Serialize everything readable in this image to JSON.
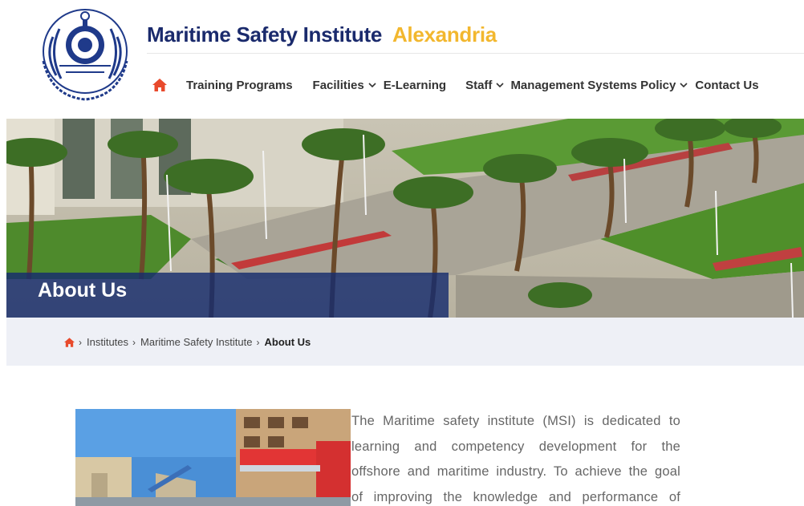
{
  "header": {
    "title_main": "Maritime Safety Institute",
    "title_accent": "Alexandria",
    "logo_icon": "academy-seal-icon"
  },
  "nav": {
    "home_icon": "home-icon",
    "items": [
      {
        "label": "Training Programs",
        "dropdown": false
      },
      {
        "label": "Facilities",
        "dropdown": true
      },
      {
        "label": "E-Learning",
        "dropdown": false
      },
      {
        "label": "Staff",
        "dropdown": true
      },
      {
        "label": "Management Systems Policy",
        "dropdown": true
      },
      {
        "label": "Contact Us",
        "dropdown": false
      }
    ]
  },
  "hero": {
    "title": "About Us"
  },
  "breadcrumb": {
    "items": [
      "Institutes",
      "Maritime Safety Institute"
    ],
    "current": "About Us"
  },
  "content": {
    "lines": [
      "The Maritime safety institute (MSI) is dedicated to",
      "learning and competency development for the",
      "offshore and maritime industry. To achieve the goal",
      "of improving the knowledge and performance of"
    ]
  },
  "colors": {
    "brand_navy": "#1a2a6c",
    "brand_gold": "#f2b72e",
    "home_red": "#e84a2c",
    "band_blue": "#162c6e"
  }
}
